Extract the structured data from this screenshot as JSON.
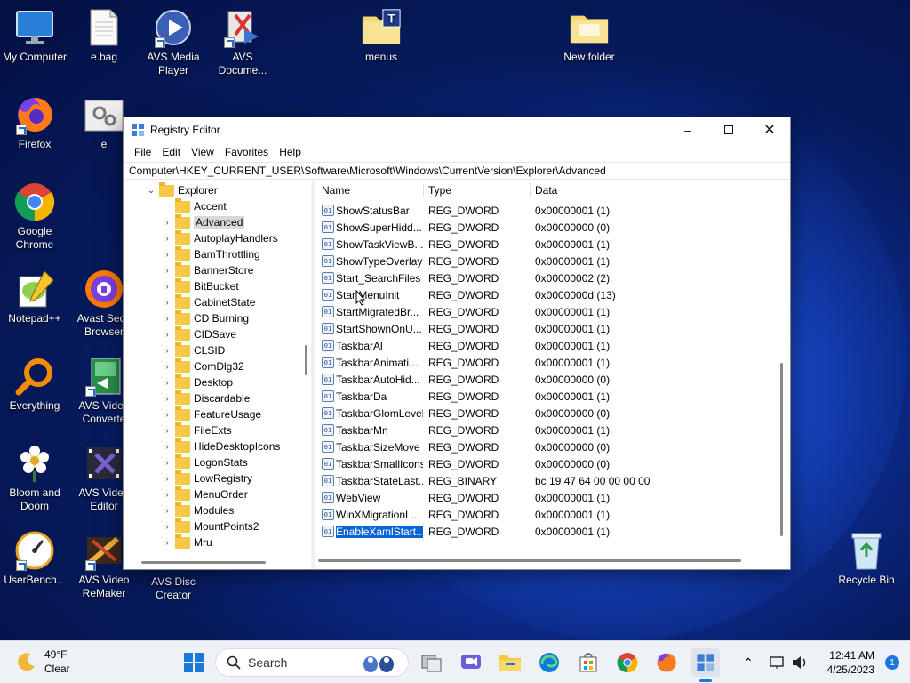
{
  "desktop_icons": [
    {
      "label": "My Computer",
      "icon": "monitor-icon"
    },
    {
      "label": "e.bag",
      "icon": "document-icon"
    },
    {
      "label": "AVS Media Player",
      "icon": "avs-media-player-icon"
    },
    {
      "label": "AVS Docume...",
      "icon": "avs-document-converter-icon"
    },
    {
      "label": "menus",
      "icon": "folder-icon"
    },
    {
      "label": "New folder",
      "icon": "folder-icon"
    },
    {
      "label": "Firefox",
      "icon": "firefox-icon"
    },
    {
      "label": "e",
      "icon": "gear-file-icon"
    },
    {
      "label": "Google Chrome",
      "icon": "chrome-icon"
    },
    {
      "label": "Notepad++",
      "icon": "notepad-plus-plus-icon"
    },
    {
      "label": "Avast Secu Browser",
      "icon": "avast-browser-icon"
    },
    {
      "label": "Everything",
      "icon": "everything-search-icon"
    },
    {
      "label": "AVS Video Converte",
      "icon": "avs-video-converter-icon"
    },
    {
      "label": "Bloom and Doom",
      "icon": "bloom-and-doom-icon"
    },
    {
      "label": "AVS Video Editor",
      "icon": "avs-video-editor-icon"
    },
    {
      "label": "UserBench...",
      "icon": "userbenchmark-icon"
    },
    {
      "label": "AVS Video ReMaker",
      "icon": "avs-video-remaker-icon"
    },
    {
      "label": "AVS Disc Creator",
      "icon": "avs-disc-creator-icon"
    },
    {
      "label": "Recycle Bin",
      "icon": "recycle-bin-icon"
    }
  ],
  "window": {
    "title": "Registry Editor",
    "menu": [
      "File",
      "Edit",
      "View",
      "Favorites",
      "Help"
    ],
    "address": "Computer\\HKEY_CURRENT_USER\\Software\\Microsoft\\Windows\\CurrentVersion\\Explorer\\Advanced",
    "tree": {
      "parent": "Explorer",
      "children": [
        "Accent",
        "Advanced",
        "AutoplayHandlers",
        "BamThrottling",
        "BannerStore",
        "BitBucket",
        "CabinetState",
        "CD Burning",
        "CIDSave",
        "CLSID",
        "ComDlg32",
        "Desktop",
        "Discardable",
        "FeatureUsage",
        "FileExts",
        "HideDesktopIcons",
        "LogonStats",
        "LowRegistry",
        "MenuOrder",
        "Modules",
        "MountPoints2",
        "Mru"
      ],
      "selected": "Advanced"
    },
    "columns": {
      "name": "Name",
      "type": "Type",
      "data": "Data"
    },
    "values": [
      {
        "name": "ShowStatusBar",
        "type": "REG_DWORD",
        "data": "0x00000001 (1)"
      },
      {
        "name": "ShowSuperHidd...",
        "type": "REG_DWORD",
        "data": "0x00000000 (0)"
      },
      {
        "name": "ShowTaskViewB...",
        "type": "REG_DWORD",
        "data": "0x00000001 (1)"
      },
      {
        "name": "ShowTypeOverlay",
        "type": "REG_DWORD",
        "data": "0x00000001 (1)"
      },
      {
        "name": "Start_SearchFiles",
        "type": "REG_DWORD",
        "data": "0x00000002 (2)"
      },
      {
        "name": "StartMenuInit",
        "type": "REG_DWORD",
        "data": "0x0000000d (13)"
      },
      {
        "name": "StartMigratedBr...",
        "type": "REG_DWORD",
        "data": "0x00000001 (1)"
      },
      {
        "name": "StartShownOnU...",
        "type": "REG_DWORD",
        "data": "0x00000001 (1)"
      },
      {
        "name": "TaskbarAl",
        "type": "REG_DWORD",
        "data": "0x00000001 (1)"
      },
      {
        "name": "TaskbarAnimati...",
        "type": "REG_DWORD",
        "data": "0x00000001 (1)"
      },
      {
        "name": "TaskbarAutoHid...",
        "type": "REG_DWORD",
        "data": "0x00000000 (0)"
      },
      {
        "name": "TaskbarDa",
        "type": "REG_DWORD",
        "data": "0x00000001 (1)"
      },
      {
        "name": "TaskbarGlomLevel",
        "type": "REG_DWORD",
        "data": "0x00000000 (0)"
      },
      {
        "name": "TaskbarMn",
        "type": "REG_DWORD",
        "data": "0x00000001 (1)"
      },
      {
        "name": "TaskbarSizeMove",
        "type": "REG_DWORD",
        "data": "0x00000000 (0)"
      },
      {
        "name": "TaskbarSmallIcons",
        "type": "REG_DWORD",
        "data": "0x00000000 (0)"
      },
      {
        "name": "TaskbarStateLast...",
        "type": "REG_BINARY",
        "data": "bc 19 47 64 00 00 00 00"
      },
      {
        "name": "WebView",
        "type": "REG_DWORD",
        "data": "0x00000001 (1)"
      },
      {
        "name": "WinXMigrationL...",
        "type": "REG_DWORD",
        "data": "0x00000001 (1)"
      },
      {
        "name": "EnableXamlStart...",
        "type": "REG_DWORD",
        "data": "0x00000001 (1)"
      }
    ],
    "selected_value": "EnableXamlStart..."
  },
  "taskbar": {
    "weather": {
      "temp": "49°F",
      "condition": "Clear"
    },
    "search_label": "Search",
    "time": "12:41 AM",
    "date": "4/25/2023",
    "notification_count": "1",
    "apps": [
      "windows-start-icon",
      "task-view-icon",
      "chat-icon",
      "file-explorer-icon",
      "edge-icon",
      "store-icon",
      "chrome-icon",
      "firefox-icon",
      "regedit-icon"
    ]
  },
  "colors": {
    "accent": "#0a64d4",
    "folder": "#f6c944",
    "taskbar": "#eef1f6"
  }
}
